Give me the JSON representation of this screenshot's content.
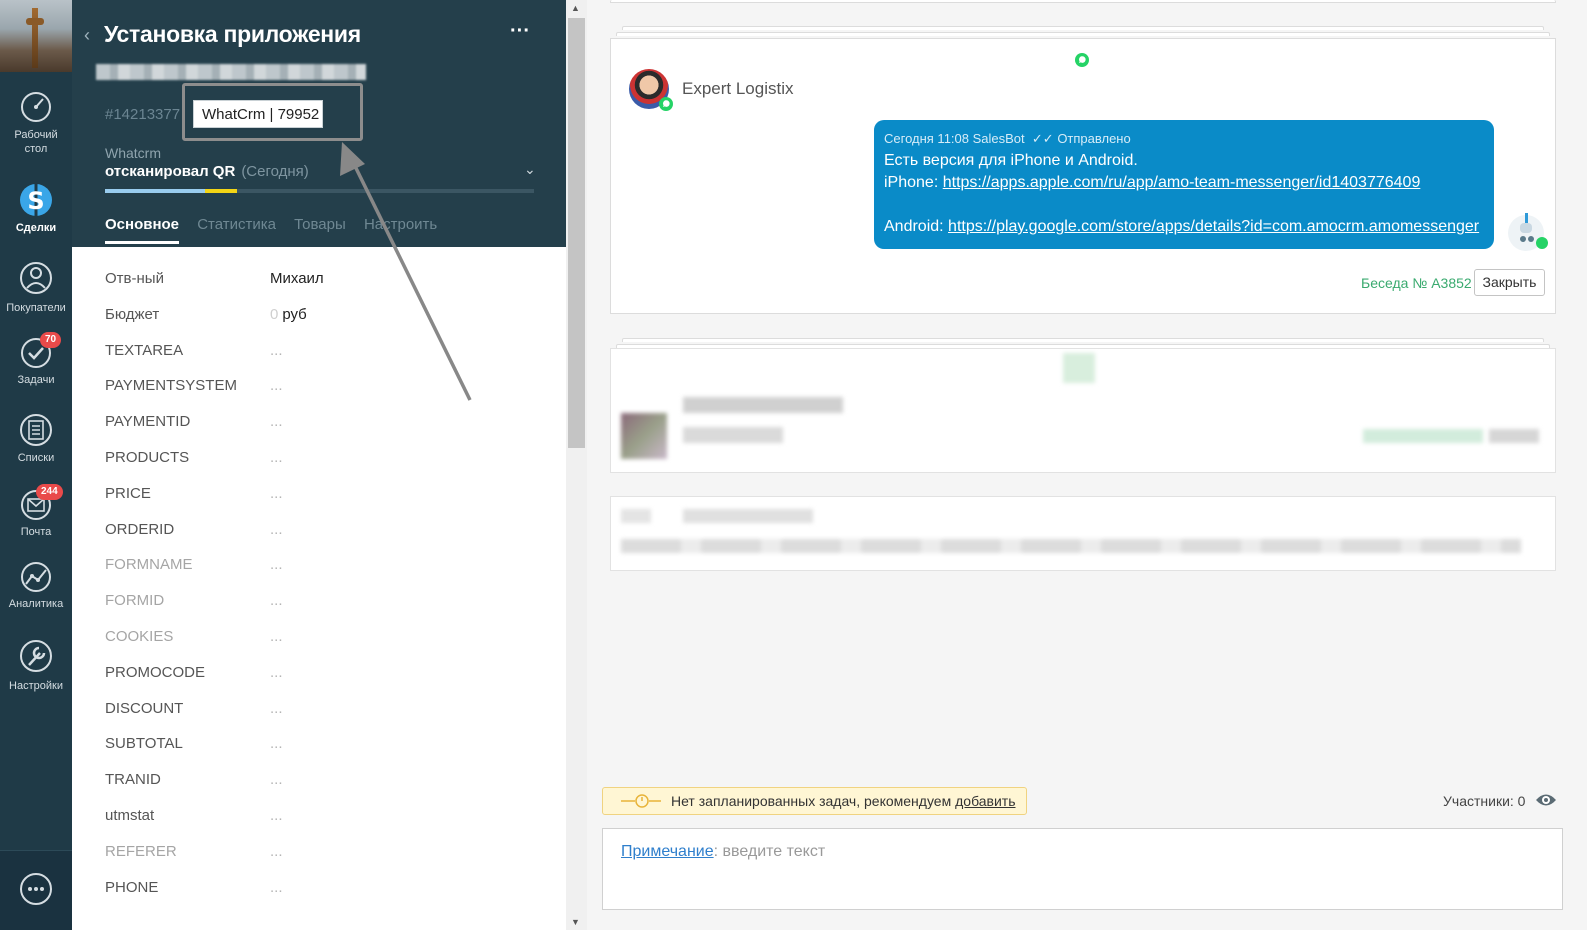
{
  "nav": {
    "items": [
      {
        "label": "Рабочий стол",
        "icon": "dashboard-icon"
      },
      {
        "label": "Сделки",
        "icon": "deals-icon"
      },
      {
        "label": "Покупатели",
        "icon": "customers-icon"
      },
      {
        "label": "Задачи",
        "icon": "tasks-icon",
        "badge": "70"
      },
      {
        "label": "Списки",
        "icon": "lists-icon"
      },
      {
        "label": "Почта",
        "icon": "mail-icon",
        "badge": "244"
      },
      {
        "label": "Аналитика",
        "icon": "analytics-icon"
      },
      {
        "label": "Настройки",
        "icon": "settings-icon"
      }
    ]
  },
  "card": {
    "title": "Установка приложения",
    "deal_id": "#14213377",
    "name_input_value": "WhatCrm | 79952",
    "pipeline": "Whatcrm",
    "status": "отсканировал QR",
    "status_when": "(Сегодня)",
    "tabs": [
      "Основное",
      "Статистика",
      "Товары",
      "Настроить"
    ],
    "fields": [
      {
        "label": "Отв-ный",
        "value": "Михаил"
      },
      {
        "label": "Бюджет",
        "value": "руб",
        "zero": "0"
      },
      {
        "label": "TEXTAREA",
        "value": "..."
      },
      {
        "label": "PAYMENTSYSTEM",
        "value": "..."
      },
      {
        "label": "PAYMENTID",
        "value": "..."
      },
      {
        "label": "PRODUCTS",
        "value": "..."
      },
      {
        "label": "PRICE",
        "value": "..."
      },
      {
        "label": "ORDERID",
        "value": "..."
      },
      {
        "label": "FORMNAME",
        "value": "..."
      },
      {
        "label": "FORMID",
        "value": "..."
      },
      {
        "label": "COOKIES",
        "value": "..."
      },
      {
        "label": "PROMOCODE",
        "value": "..."
      },
      {
        "label": "DISCOUNT",
        "value": "..."
      },
      {
        "label": "SUBTOTAL",
        "value": "..."
      },
      {
        "label": "TRANID",
        "value": "..."
      },
      {
        "label": "utmstat",
        "value": "..."
      },
      {
        "label": "REFERER",
        "value": "..."
      },
      {
        "label": "PHONE",
        "value": "..."
      }
    ]
  },
  "feed": {
    "contact_name": "Expert Logistix",
    "message": {
      "meta": "Сегодня 11:08 SalesBot",
      "status": "Отправлено",
      "line1": "Есть версия для iPhone и Android.",
      "iphone_prefix": "iPhone:",
      "iphone_link": "https://apps.apple.com/ru/app/amo-team-messenger/id1403776409",
      "android_prefix": "Android:",
      "android_link": "https://play.google.com/store/apps/details?id=com.amocrm.amomessenger"
    },
    "conversation_label": "Беседа № А3852",
    "close_button": "Закрыть",
    "task_notice": "Нет запланированных задач, рекомендуем",
    "task_add_link": "добавить",
    "participants": "Участники: 0",
    "note_link": "Примечание",
    "note_placeholder": ": введите текст"
  },
  "colors": {
    "nav_bg": "#1f3a47",
    "card_head_bg": "#243f4b",
    "bubble_bg": "#0a8bc8",
    "whatsapp": "#25d366",
    "conversation_green": "#3aaa6f"
  }
}
